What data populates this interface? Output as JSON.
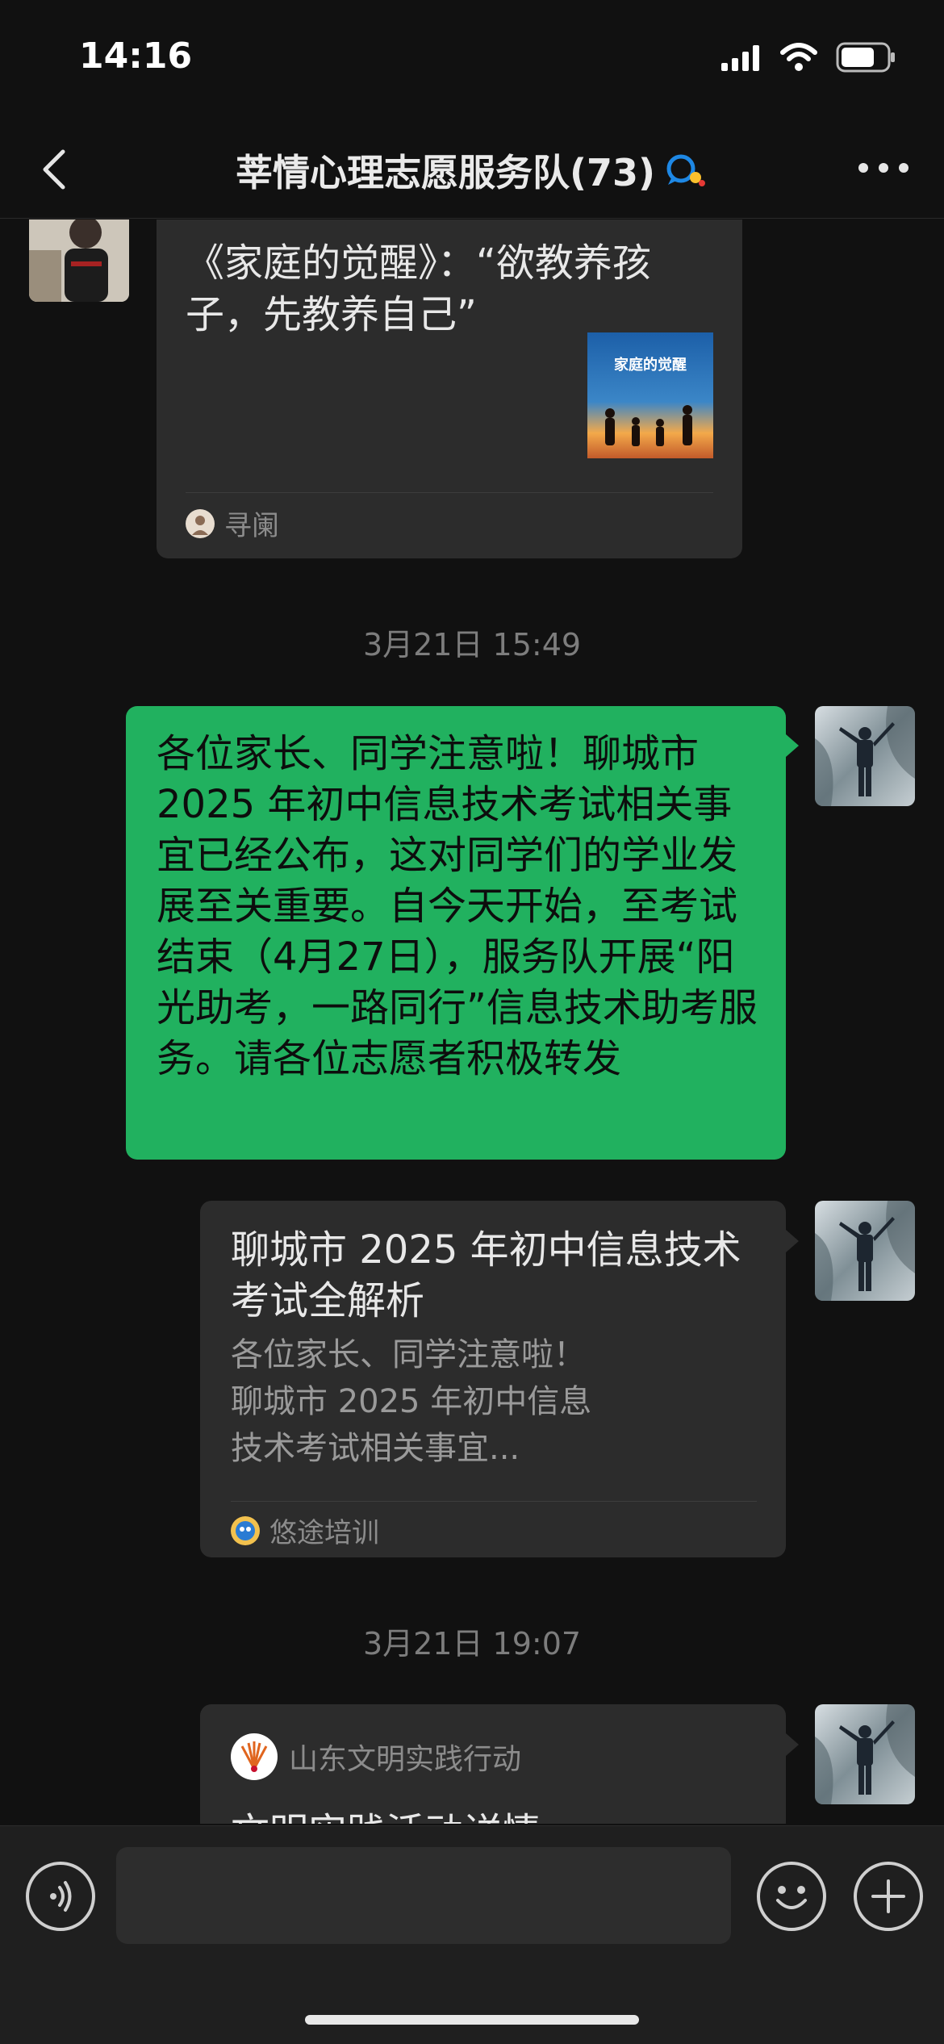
{
  "status": {
    "time": "14:16"
  },
  "header": {
    "title": "莘情心理志愿服务队(73)"
  },
  "messages": {
    "card1": {
      "title": "《家庭的觉醒》：“欲教养孩子，先教养自己”",
      "source": "寻阑",
      "thumb_title": "家庭的觉醒"
    },
    "time1": "3月21日 15:49",
    "text1": "各位家长、同学注意啦！聊城市 2025 年初中信息技术考试相关事宜已经公布，这对同学们的学业发展至关重要。自今天开始，至考试结束（4月27日），服务队开展“阳光助考，一路同行”信息技术助考服务。请各位志愿者积极转发",
    "card2": {
      "title": "聊城市 2025 年初中信息技术考试全解析",
      "desc": "各位家长、同学注意啦！聊城市 2025 年初中信息技术考试相关事宜...",
      "source": "悠途培训"
    },
    "time2": "3月21日 19:07",
    "card3": {
      "source": "山东文明实践行动",
      "title": "文明实践活动详情"
    }
  },
  "colors": {
    "accent_green": "#21b15f",
    "card_bg": "#2c2c2c",
    "bg": "#111111"
  },
  "icons": [
    "back-icon",
    "group-chat-icon",
    "more-icon",
    "signal-icon",
    "wifi-icon",
    "battery-icon",
    "voice-icon",
    "emoji-icon",
    "plus-icon"
  ]
}
